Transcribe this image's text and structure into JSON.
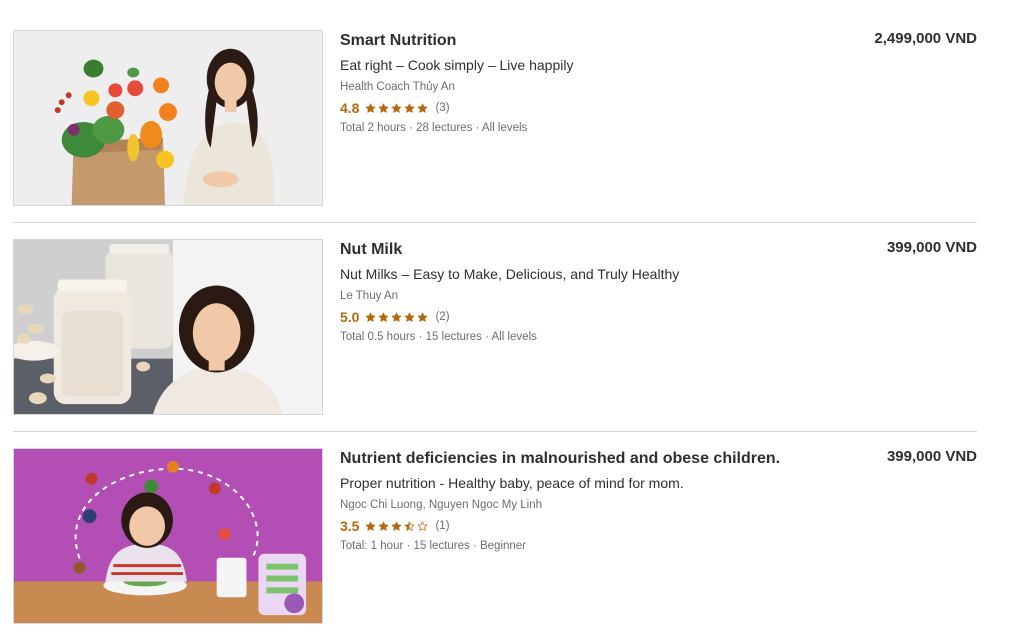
{
  "currency_note": "",
  "colors": {
    "rating": "#b4690e",
    "text": "#2d2f31",
    "muted": "#6a6f73",
    "divider": "#d1d7dc"
  },
  "courses": [
    {
      "title": "Smart Nutrition",
      "headline": "Eat right – Cook simply – Live happily",
      "instructor": "Health Coach Thủy An",
      "rating": "4.8",
      "rating_value": 4.8,
      "reviews": "(3)",
      "meta": "Total 2 hours · 28 lectures · All levels",
      "price": "2,499,000 VND",
      "thumbnail": "vegetables-bag-and-smiling-woman-image"
    },
    {
      "title": "Nut Milk",
      "headline": "Nut Milks – Easy to Make, Delicious, and Truly Healthy",
      "instructor": "Le Thuy An",
      "rating": "5.0",
      "rating_value": 5.0,
      "reviews": "(2)",
      "meta": "Total 0.5 hours · 15 lectures · All levels",
      "price": "399,000 VND",
      "thumbnail": "nut-milk-jars-and-smiling-woman-image"
    },
    {
      "title": "Nutrient deficiencies in malnourished and obese children.",
      "headline": "Proper nutrition - Healthy baby, peace of mind for mom.",
      "instructor": "Ngoc Chi Luong, Nguyen Ngoc My Linh",
      "rating": "3.5",
      "rating_value": 3.5,
      "reviews": "(1)",
      "meta": "Total: 1 hour · 15 lectures · Beginner",
      "price": "399,000 VND",
      "thumbnail": "child-with-food-on-purple-background-image"
    }
  ]
}
